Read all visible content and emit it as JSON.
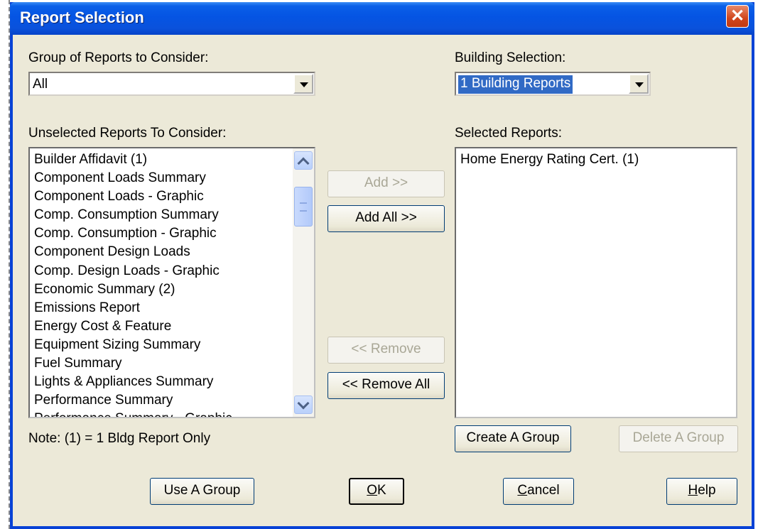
{
  "window": {
    "title": "Report Selection",
    "close_glyph": "✕"
  },
  "group": {
    "label": "Group of Reports to Consider:",
    "value": "All"
  },
  "building": {
    "label": "Building Selection:",
    "value": "1 Building Reports"
  },
  "unselected": {
    "label": "Unselected Reports To Consider:",
    "items": [
      "Builder Affidavit (1)",
      "Component Loads Summary",
      "Component Loads - Graphic",
      "Comp. Consumption Summary",
      "Comp. Consumption - Graphic",
      "Component Design Loads",
      "Comp. Design Loads - Graphic",
      "Economic Summary (2)",
      "Emissions Report",
      "Energy Cost & Feature",
      "Equipment Sizing Summary",
      "Fuel Summary",
      "Lights & Appliances Summary",
      "Performance Summary",
      "Performance Summary - Graphic"
    ]
  },
  "selected": {
    "label": "Selected Reports:",
    "items": [
      "Home Energy Rating Cert. (1)"
    ]
  },
  "buttons": {
    "add": "Add >>",
    "add_all": "Add All >>",
    "remove": "<< Remove",
    "remove_all": "<< Remove All",
    "create_group": "Create A Group",
    "delete_group": "Delete A Group",
    "use_group": "Use A Group",
    "ok_mnemonic": "O",
    "ok_rest": "K",
    "cancel_mnemonic": "C",
    "cancel_rest": "ancel",
    "help_mnemonic": "H",
    "help_rest": "elp"
  },
  "note": "Note: (1) = 1 Bldg Report Only",
  "colors": {
    "titlebar": "#0554e3",
    "client": "#ece9d8",
    "selection": "#316ac5",
    "close": "#d0451c"
  }
}
